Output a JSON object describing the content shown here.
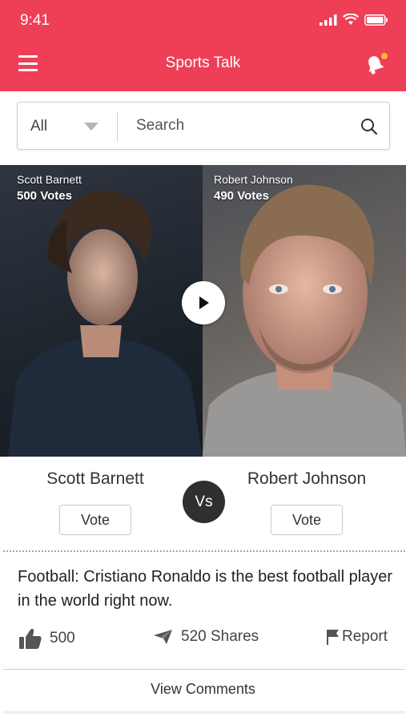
{
  "status_bar": {
    "time": "9:41"
  },
  "app_bar": {
    "title": "Sports Talk",
    "has_notification": true,
    "notification_dot_color": "#f7b733",
    "accent_color": "#ee3f57"
  },
  "search": {
    "filter_value": "All",
    "placeholder": "Search"
  },
  "matchup": {
    "left": {
      "name": "Scott Barnett",
      "votes_label": "500 Votes",
      "vote_button": "Vote"
    },
    "right": {
      "name": "Robert Johnson",
      "votes_label": "490 Votes",
      "vote_button": "Vote"
    },
    "vs_label": "Vs"
  },
  "post": {
    "text": "Football: Cristiano Ronaldo is the best football player in the world right now.",
    "likes": "500",
    "shares": "520 Shares",
    "report": "Report"
  },
  "footer": {
    "view_comments": "View Comments"
  },
  "icons": {
    "menu": "hamburger-menu-icon",
    "notifications": "bell-icon",
    "search": "search-icon",
    "play": "play-icon",
    "like": "thumbs-up-icon",
    "share": "paper-plane-icon",
    "report": "flag-icon"
  }
}
